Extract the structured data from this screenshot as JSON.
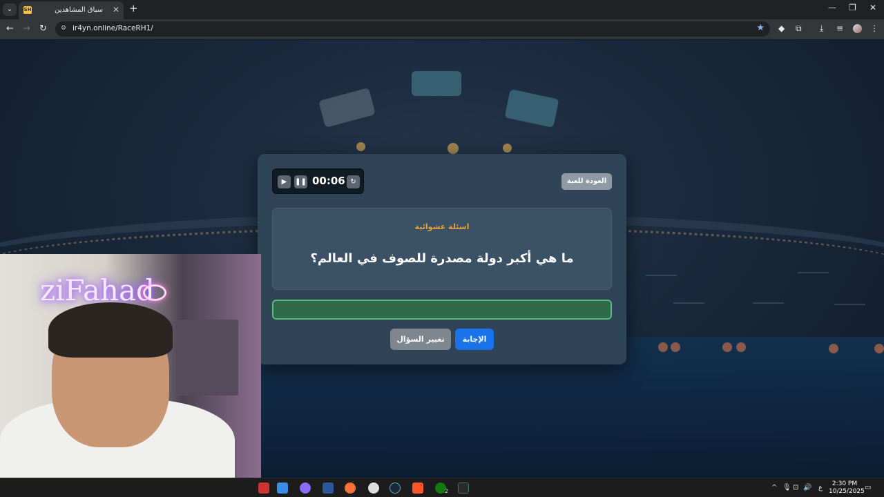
{
  "browser": {
    "tab_title": "سباق المشاهدين",
    "tab_close": "✕",
    "new_tab": "+",
    "url": "ir4yn.online/RaceRH1/"
  },
  "modal": {
    "timer": "00:06",
    "back_label": "العودة للعبة",
    "category": "اسئلة عشوائية",
    "question": "ما هي أكبر دولة مصدرة للصوف في العالم؟",
    "answer_value": "",
    "answer_button": "الإجابة",
    "change_button": "تغيير السؤال"
  },
  "webcam": {
    "neon_text": "ziFahad"
  },
  "taskbar": {
    "time": "2:30 PM",
    "date": "10/25/2025",
    "lang": "ع",
    "xbox_badge": "2"
  },
  "colors": {
    "accent": "#1a73e8",
    "category": "#e6a437",
    "answer_border": "#4fbf7a",
    "modal_bg": "#2f4457"
  }
}
